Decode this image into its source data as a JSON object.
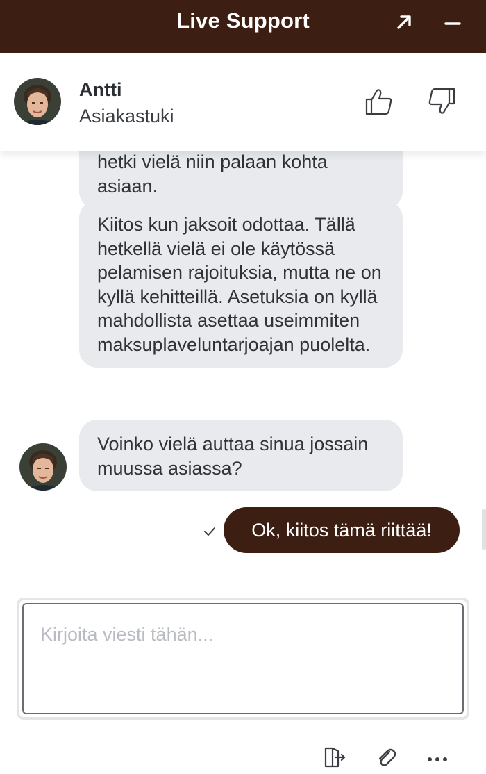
{
  "window": {
    "title": "Live Support",
    "expand_icon": "expand-arrow-icon",
    "minimize_icon": "minimize-icon"
  },
  "agent": {
    "name": "Antti",
    "role": "Asiakastuki",
    "avatar_icon": "agent-avatar",
    "rate_up_icon": "thumbs-up-icon",
    "rate_down_icon": "thumbs-down-icon"
  },
  "messages": [
    {
      "from": "agent",
      "text": "hetki vielä niin palaan kohta asiaan."
    },
    {
      "from": "agent",
      "text": "Kiitos kun jaksoit odottaa. Tällä hetkellä vielä ei ole käytössä pelamisen rajoituksia, mutta ne on kyllä kehitteillä. Asetuksia on kyllä mahdollista asettaa useimmiten maksuplaveluntarjoajan puolelta."
    },
    {
      "from": "agent",
      "text": "Voinko vielä auttaa sinua jossain muussa asiassa?"
    },
    {
      "from": "user",
      "text": "Ok, kiitos tämä riittää!",
      "status_icon": "check-icon"
    }
  ],
  "composer": {
    "placeholder": "Kirjoita viesti tähän...",
    "value": ""
  },
  "toolbar": {
    "exit_icon": "exit-chat-icon",
    "attach_icon": "paperclip-icon",
    "more_icon": "more-dots-icon"
  },
  "colors": {
    "brand": "#3d1e12",
    "agent_bubble": "#e8eaed",
    "text": "#2f3338",
    "placeholder": "#b8bcc2"
  }
}
